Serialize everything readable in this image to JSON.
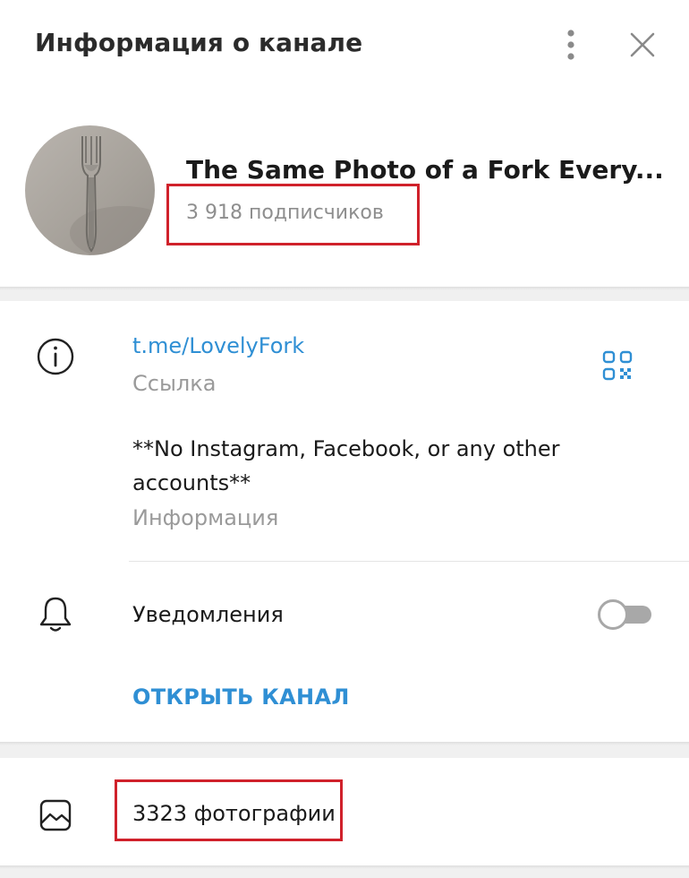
{
  "header": {
    "title": "Информация о канале",
    "menu_icon": "more-vertical-icon",
    "close_icon": "close-icon"
  },
  "profile": {
    "name": "The Same Photo of a Fork Every...",
    "subscribers": "3 918 подписчиков",
    "avatar_icon": "fork-photo-avatar"
  },
  "info": {
    "link": "t.me/LovelyFork",
    "link_label": "Ссылка",
    "qr_icon": "qr-code-icon",
    "description": "**No Instagram, Facebook, or any other accounts**",
    "description_label": "Информация",
    "notifications_label": "Уведомления",
    "notifications_enabled": false,
    "open_channel": "ОТКРЫТЬ КАНАЛ"
  },
  "media": {
    "photos": "3323 фотографии"
  },
  "colors": {
    "accent": "#2f8fd4",
    "highlight": "#d0212b",
    "muted": "#9a9a9a"
  }
}
